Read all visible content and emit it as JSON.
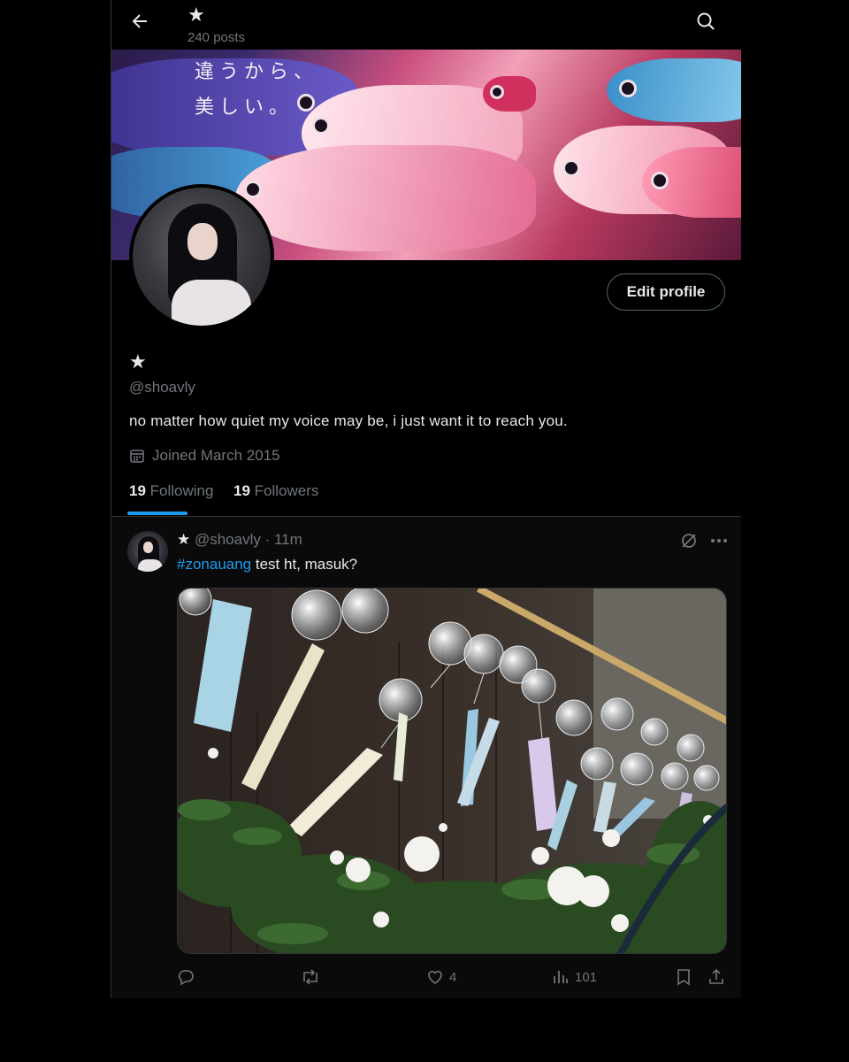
{
  "header": {
    "title_icon": "star-icon",
    "post_count": "240 posts"
  },
  "banner": {
    "text_line1": "違うから、",
    "text_line2": "美しい。"
  },
  "profile": {
    "name_icon": "star-icon",
    "handle": "@shoavly",
    "bio": "no matter how quiet my voice may be,  i just want it to reach you.",
    "joined": "Joined March 2015",
    "following_count": "19",
    "following_label": "Following",
    "followers_count": "19",
    "followers_label": "Followers",
    "edit_button": "Edit profile"
  },
  "post": {
    "handle_meta": "@shoavly · 11m",
    "hashtag": "#zonauang",
    "text": " test ht, masuk?",
    "likes": "4",
    "views": "101"
  },
  "colors": {
    "accent": "#1d9bf0",
    "muted": "#71767b",
    "text": "#e7e9ea"
  }
}
